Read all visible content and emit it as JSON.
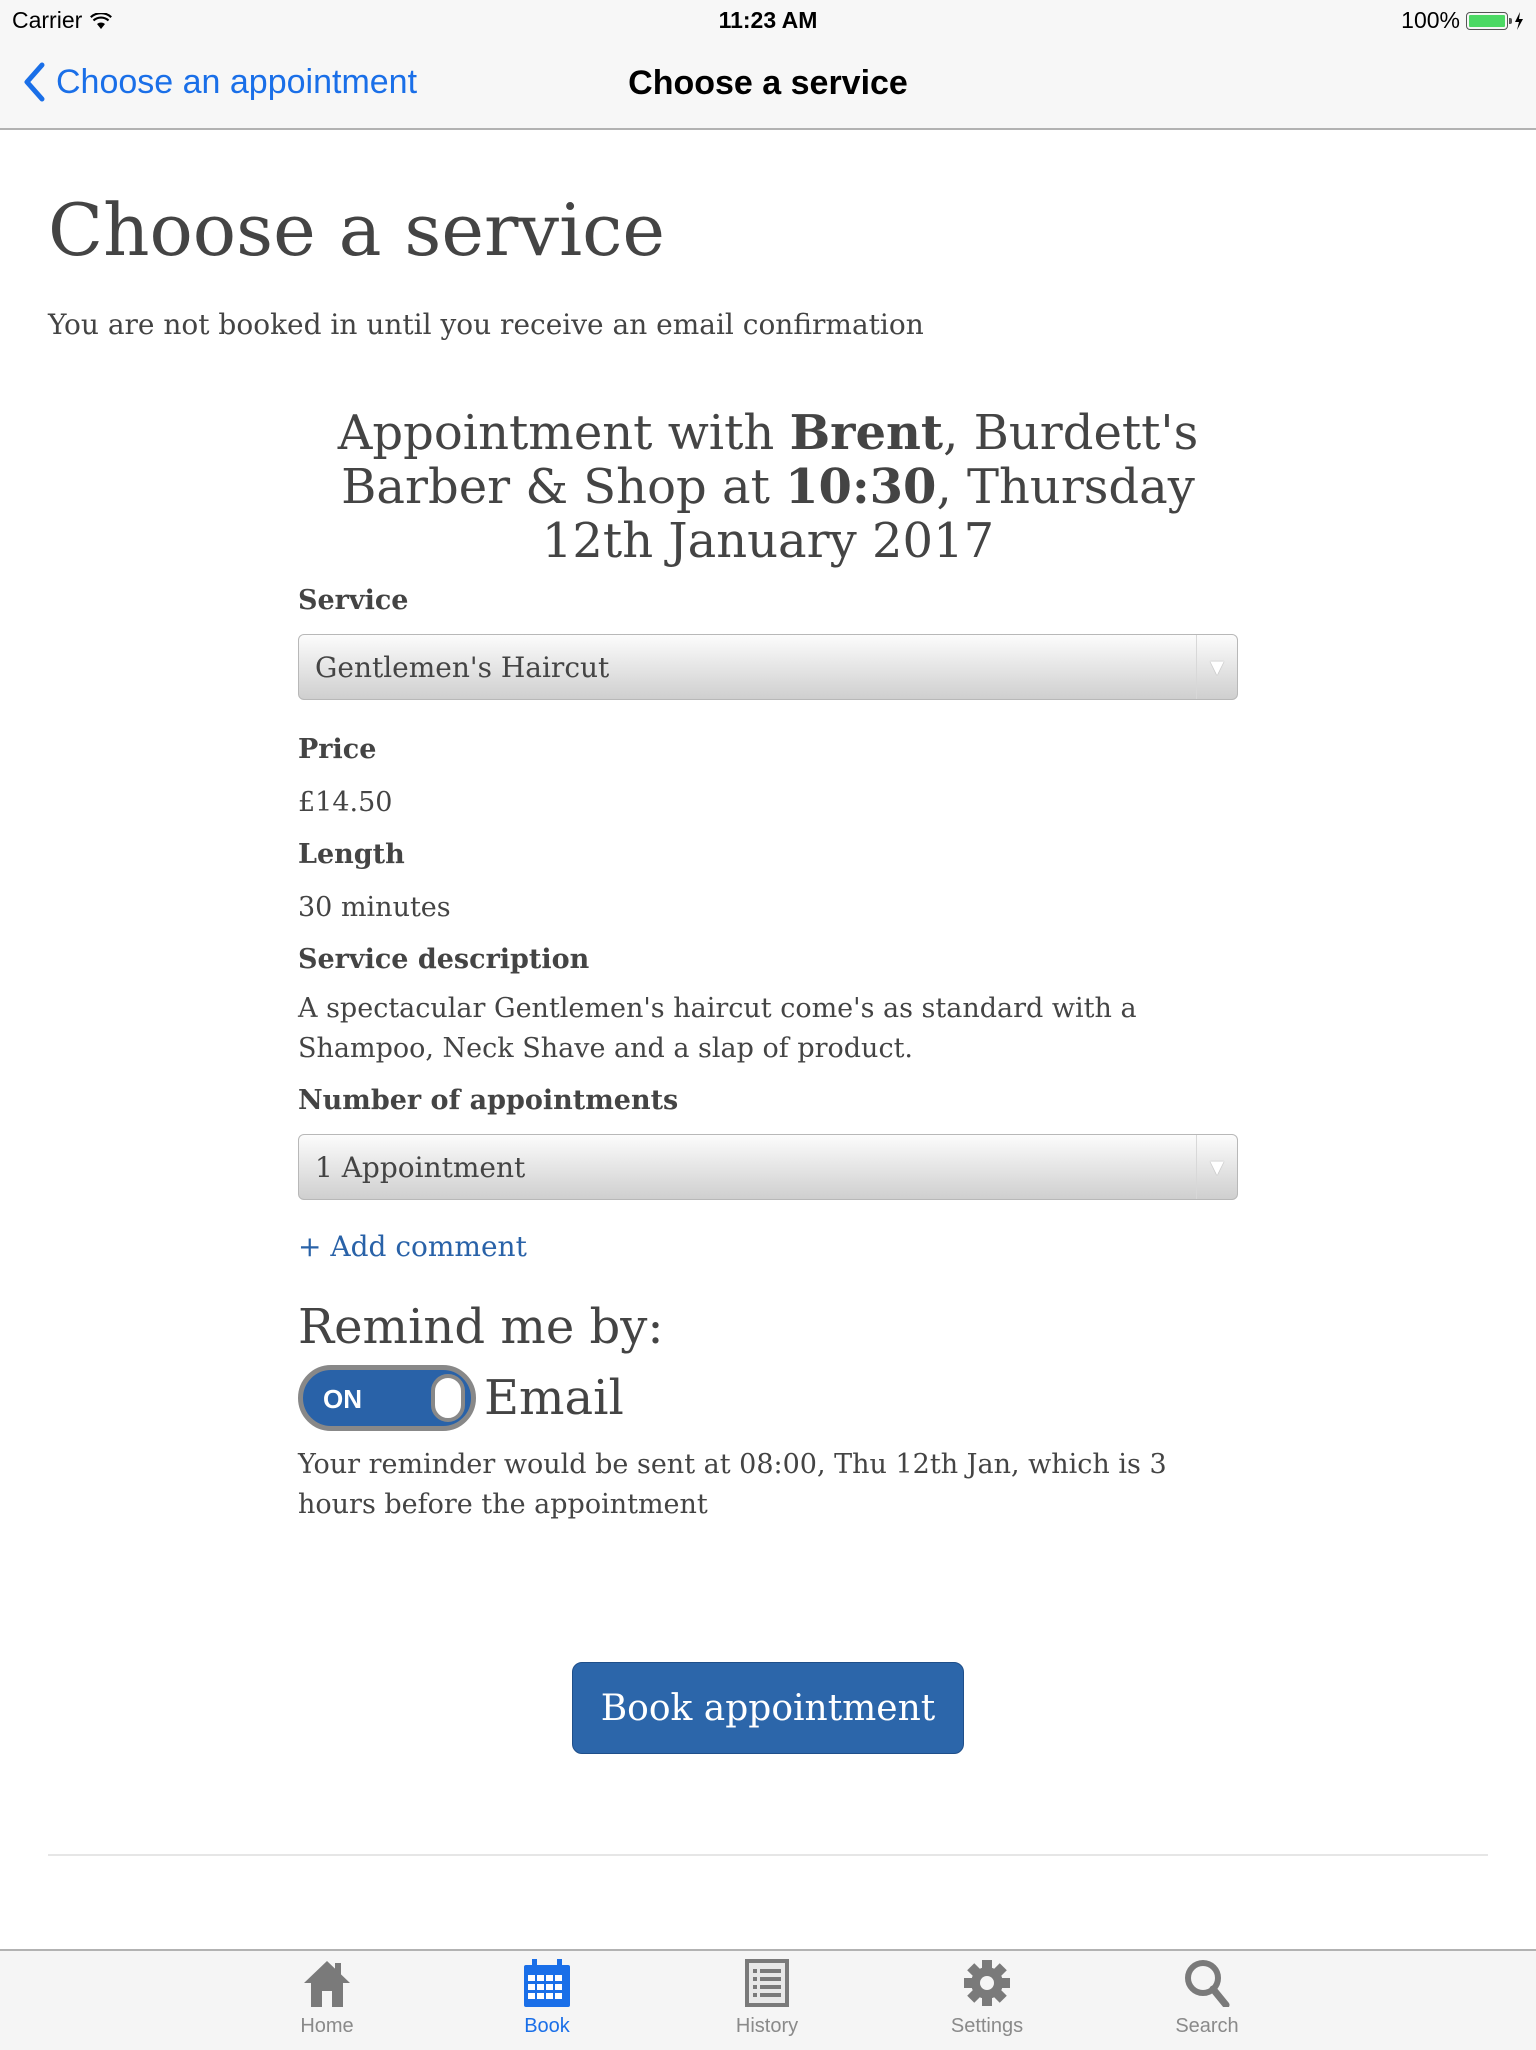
{
  "status_bar": {
    "carrier": "Carrier",
    "time": "11:23 AM",
    "battery": "100%"
  },
  "nav": {
    "back_label": "Choose an appointment",
    "title": "Choose a service"
  },
  "page": {
    "heading": "Choose a service",
    "notice": "You are not booked in until you receive an email confirmation",
    "appointment": {
      "prefix": "Appointment with ",
      "staff": "Brent",
      "shop": ", Burdett's Barber & Shop at ",
      "time": "10:30",
      "date": ", Thursday 12th January 2017"
    },
    "service": {
      "label": "Service",
      "selected": "Gentlemen's Haircut"
    },
    "price": {
      "label": "Price",
      "value": "£14.50"
    },
    "length": {
      "label": "Length",
      "value": "30 minutes"
    },
    "description": {
      "label": "Service description",
      "value": "A spectacular Gentlemen's haircut come's as standard with a Shampoo, Neck Shave and a slap of product."
    },
    "count": {
      "label": "Number of appointments",
      "selected": "1 Appointment"
    },
    "add_comment": "+ Add comment",
    "remind": {
      "heading": "Remind me by:",
      "toggle_state": "ON",
      "method": "Email",
      "note": "Your reminder would be sent at 08:00, Thu 12th Jan, which is 3 hours before the appointment"
    },
    "book_button": "Book appointment"
  },
  "tabs": [
    {
      "label": "Home",
      "icon": "home-icon",
      "active": false
    },
    {
      "label": "Book",
      "icon": "calendar-icon",
      "active": true
    },
    {
      "label": "History",
      "icon": "list-icon",
      "active": false
    },
    {
      "label": "Settings",
      "icon": "gear-icon",
      "active": false
    },
    {
      "label": "Search",
      "icon": "search-icon",
      "active": false
    }
  ],
  "colors": {
    "ios_blue": "#1a6fe8",
    "brand_blue": "#2c66aa",
    "text": "#444444"
  }
}
